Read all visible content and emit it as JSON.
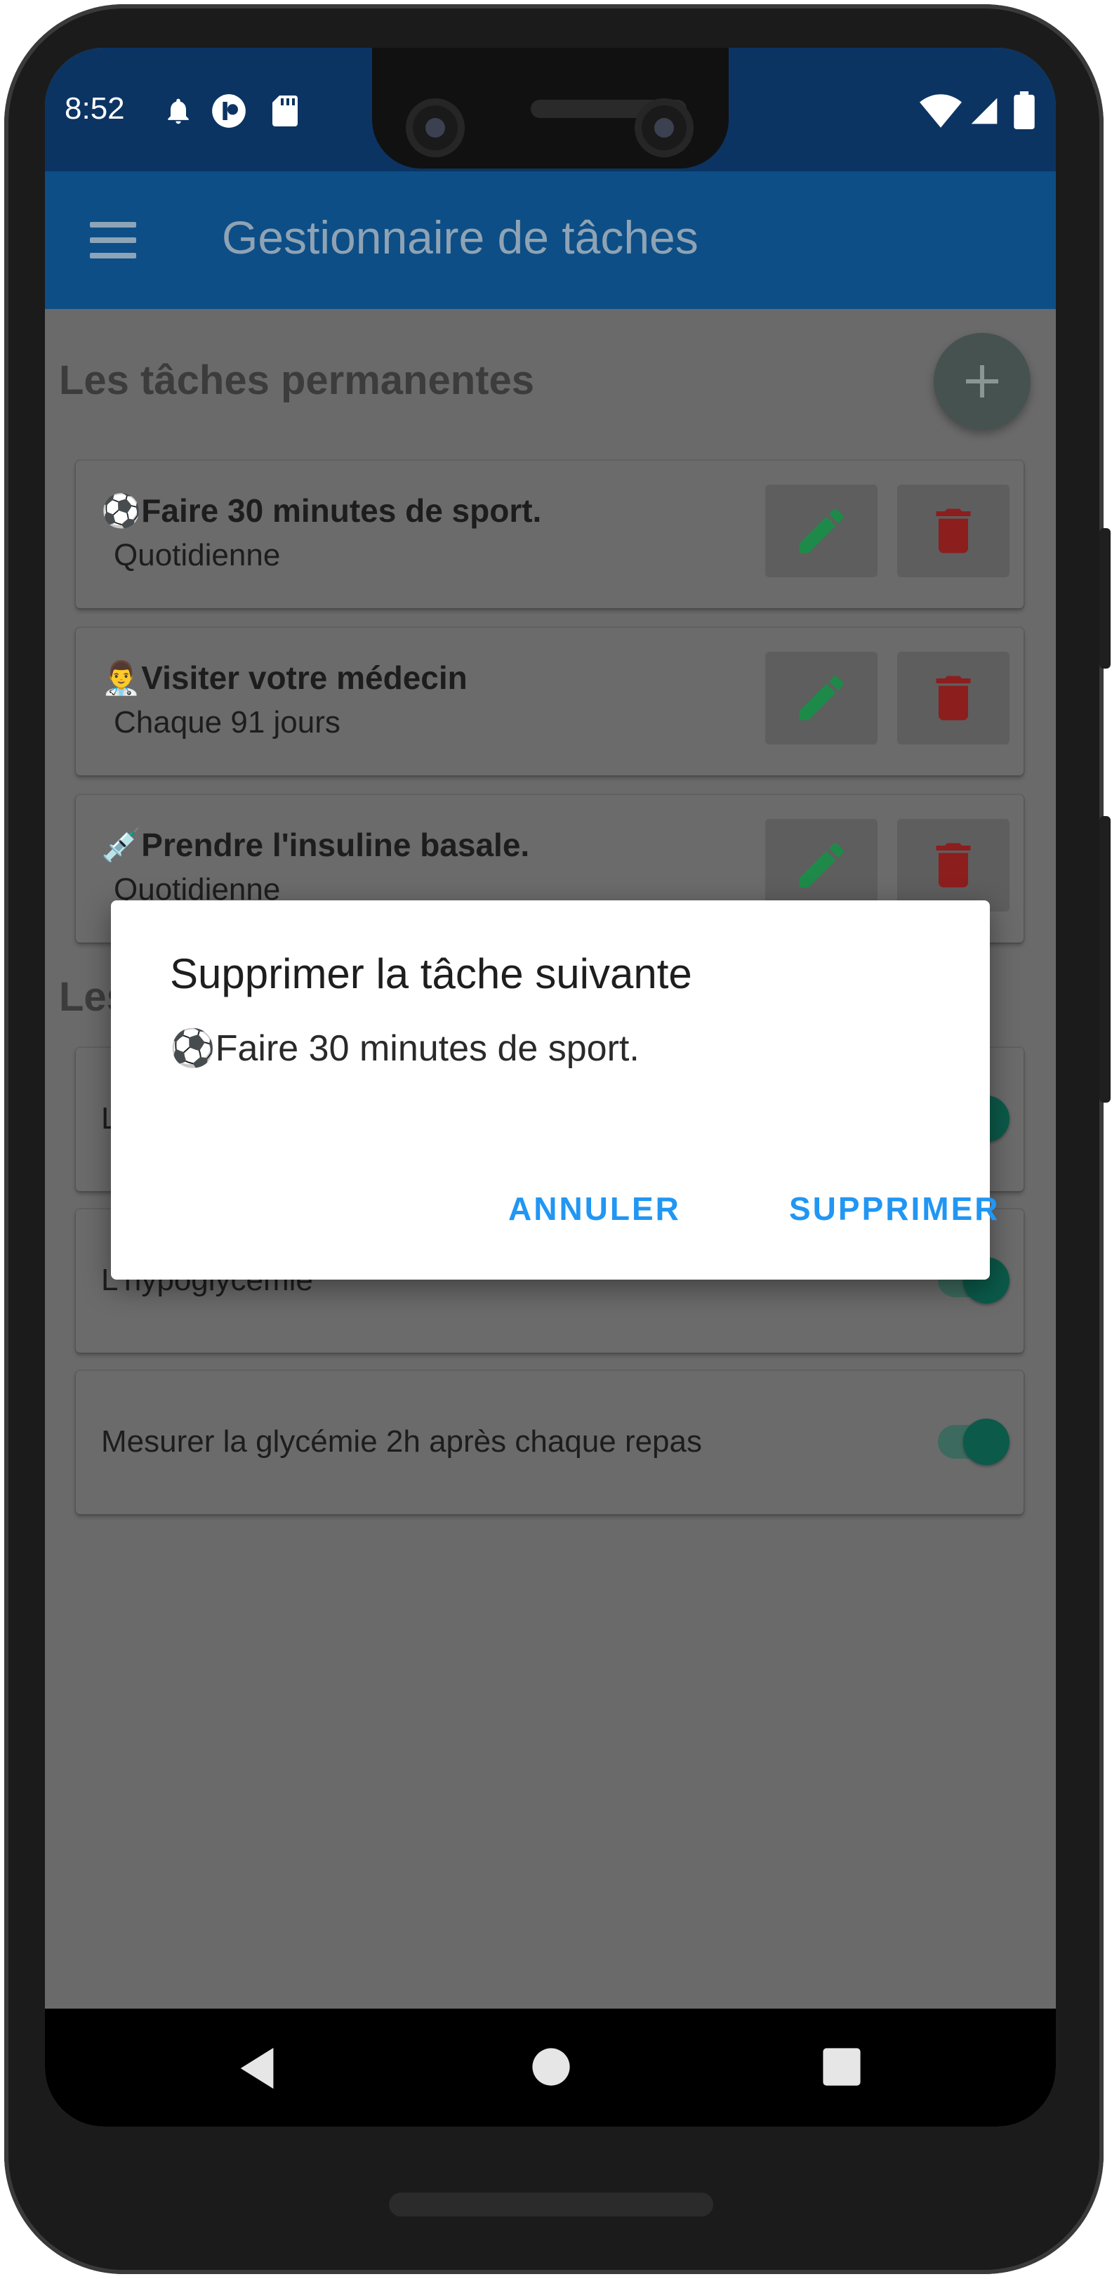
{
  "status_bar": {
    "time": "8:52",
    "icons": [
      "bell-icon",
      "lastpass-icon",
      "sd-card-icon",
      "wifi-icon",
      "signal-icon",
      "battery-icon"
    ]
  },
  "app_bar": {
    "title": "Gestionnaire de tâches",
    "menu_icon": "menu-icon"
  },
  "permanent_tasks": {
    "heading": "Les tâches permanentes",
    "add_icon": "plus-icon",
    "items": [
      {
        "emoji": "⚽",
        "title": "Faire 30 minutes de sport.",
        "frequency": "Quotidienne"
      },
      {
        "emoji": "👨‍⚕️",
        "title": "Visiter votre médecin",
        "frequency": "Chaque 91 jours"
      },
      {
        "emoji": "💉",
        "title": "Prendre l'insuline basale.",
        "frequency": "Quotidienne"
      }
    ]
  },
  "second_section": {
    "heading_partial": "Les",
    "items": [
      {
        "label_partial": "L",
        "enabled": true
      },
      {
        "label_partial": "L'hypoglycémie",
        "enabled": true
      },
      {
        "label": "Mesurer la glycémie 2h après chaque repas",
        "enabled": true
      }
    ]
  },
  "dialog": {
    "title": "Supprimer la tâche suivante",
    "message": "⚽Faire 30 minutes de sport.",
    "cancel_label": "ANNULER",
    "confirm_label": "SUPPRIMER"
  },
  "nav_bar": {
    "icons": [
      "back-icon",
      "home-icon",
      "recents-icon"
    ]
  },
  "colors": {
    "status_bar": "#0b3463",
    "app_bar": "#0d4e86",
    "dialog_button": "#2196f3",
    "edit_icon": "#1e8a49",
    "delete_icon": "#8c1e1e",
    "toggle": "#0b5a4a"
  }
}
